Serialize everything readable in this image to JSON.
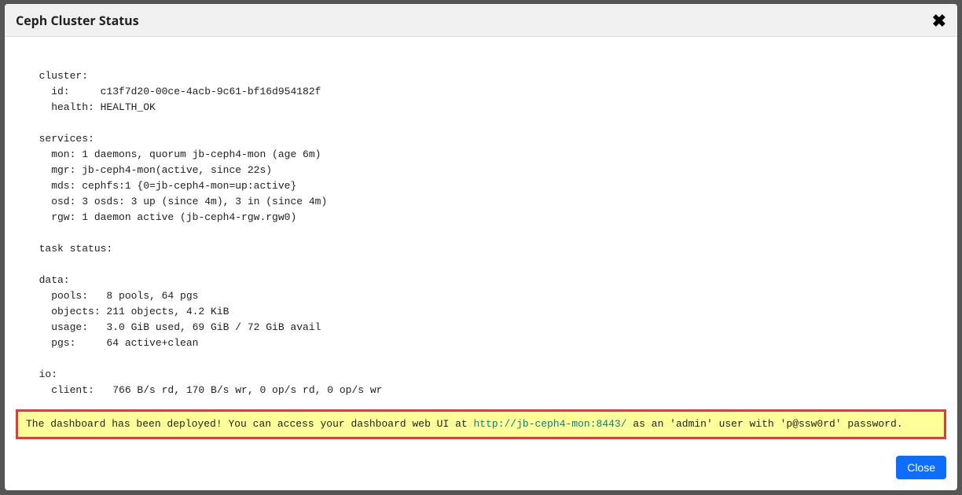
{
  "modal": {
    "title": "Ceph Cluster Status",
    "close_button_label": "Close"
  },
  "status": {
    "cluster_header": "  cluster:",
    "cluster_id": "    id:     c13f7d20-00ce-4acb-9c61-bf16d954182f",
    "cluster_health": "    health: HEALTH_OK",
    "services_header": "  services:",
    "services_mon": "    mon: 1 daemons, quorum jb-ceph4-mon (age 6m)",
    "services_mgr": "    mgr: jb-ceph4-mon(active, since 22s)",
    "services_mds": "    mds: cephfs:1 {0=jb-ceph4-mon=up:active}",
    "services_osd": "    osd: 3 osds: 3 up (since 4m), 3 in (since 4m)",
    "services_rgw": "    rgw: 1 daemon active (jb-ceph4-rgw.rgw0)",
    "task_header": "  task status:",
    "data_header": "  data:",
    "data_pools": "    pools:   8 pools, 64 pgs",
    "data_objects": "    objects: 211 objects, 4.2 KiB",
    "data_usage": "    usage:   3.0 GiB used, 69 GiB / 72 GiB avail",
    "data_pgs": "    pgs:     64 active+clean",
    "io_header": "  io:",
    "io_client": "    client:   766 B/s rd, 170 B/s wr, 0 op/s rd, 0 op/s wr"
  },
  "highlight": {
    "text_before": "The dashboard has been deployed! You can access your dashboard web UI at ",
    "url": "http://jb-ceph4-mon:8443/",
    "text_after": " as an 'admin' user with 'p@ssw0rd' password."
  }
}
